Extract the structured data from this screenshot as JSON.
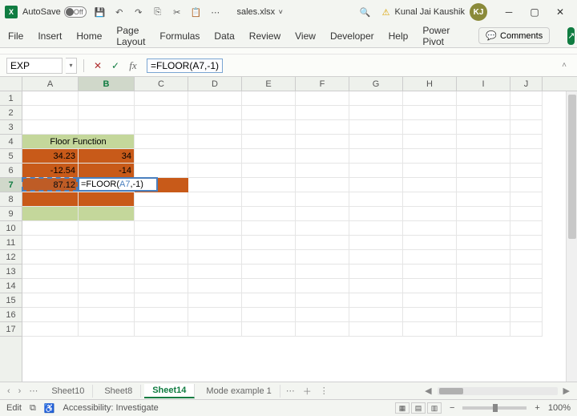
{
  "titlebar": {
    "autosave_label": "AutoSave",
    "autosave_state": "Off",
    "filename": "sales.xlsx",
    "username": "Kunal Jai Kaushik",
    "avatar_initials": "KJ"
  },
  "ribbon": {
    "tabs": [
      "File",
      "Insert",
      "Home",
      "Page Layout",
      "Formulas",
      "Data",
      "Review",
      "View",
      "Developer",
      "Help",
      "Power Pivot"
    ],
    "comments_label": "Comments"
  },
  "formula_bar": {
    "namebox": "EXP",
    "formula": "=FLOOR(A7,-1)",
    "fx_label": "fx"
  },
  "grid": {
    "columns": [
      "A",
      "B",
      "C",
      "D",
      "E",
      "F",
      "G",
      "H",
      "I",
      "J"
    ],
    "rows": [
      1,
      2,
      3,
      4,
      5,
      6,
      7,
      8,
      9,
      10,
      11,
      12,
      13,
      14,
      15,
      16,
      17
    ],
    "selected_col": "B",
    "selected_row": 7,
    "merged_header": {
      "row": 4,
      "colspan": "A:B",
      "value": "Floor Function"
    },
    "data": {
      "A5": "34.23",
      "B5": "34",
      "A6": "-12.54",
      "B6": "-14",
      "A7": "87.12",
      "B7_editing": "=FLOOR(A7,-1)",
      "B7_display_prefix": "=FLOOR(",
      "B7_display_ref": "A7",
      "B7_display_suffix": ",-1)"
    }
  },
  "sheettabs": {
    "tabs": [
      "Sheet10",
      "Sheet8",
      "Sheet14",
      "Mode example 1"
    ],
    "active": "Sheet14"
  },
  "status": {
    "mode": "Edit",
    "accessibility": "Accessibility: Investigate",
    "zoom": "100%"
  }
}
